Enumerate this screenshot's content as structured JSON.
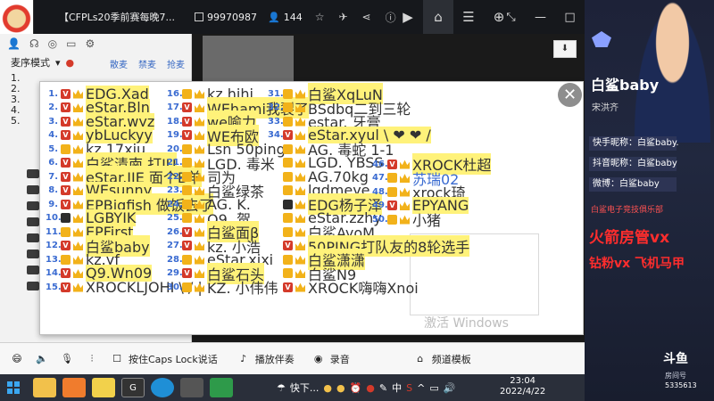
{
  "titlebar": {
    "title": "【CFPLs20季前赛每晚7...",
    "room_id": "99970987",
    "viewers": "144"
  },
  "sidepanel": {
    "mode_label": "麦序模式"
  },
  "tools": {
    "scatter": "散麦",
    "ban_mic": "禁麦",
    "grab_mic": "抢麦"
  },
  "scroll_btn": "⬇",
  "bg_list": [
    "1.",
    "2.",
    "3.",
    "4.",
    "5."
  ],
  "list": {
    "col1": [
      {
        "num": "1.",
        "name": "EDG.Xad",
        "badge": "v",
        "style": "y"
      },
      {
        "num": "2.",
        "name": "eStar.Bln",
        "badge": "v",
        "style": "y"
      },
      {
        "num": "3.",
        "name": "eStar.wyz",
        "badge": "v",
        "style": "y"
      },
      {
        "num": "4.",
        "name": "ybLuckyy",
        "badge": "v",
        "style": "y"
      },
      {
        "num": "5.",
        "name": "kz.17xiu",
        "badge": "c",
        "style": ""
      },
      {
        "num": "6.",
        "name": "白鲨清南 打JU",
        "badge": "v",
        "style": "y"
      },
      {
        "num": "7.",
        "name": "eStar.JIE 面个B羊",
        "badge": "v",
        "style": "y"
      },
      {
        "num": "8.",
        "name": "WEsunny",
        "badge": "v",
        "style": "y"
      },
      {
        "num": "9.",
        "name": "EPBigfish 做饭去了",
        "badge": "v",
        "style": "y"
      },
      {
        "num": "10.",
        "name": "LGBYIK",
        "badge": "k",
        "style": "y"
      },
      {
        "num": "11.",
        "name": "EPFirst",
        "badge": "c",
        "style": "y"
      },
      {
        "num": "12.",
        "name": "白鲨baby",
        "badge": "v",
        "style": "y"
      },
      {
        "num": "13.",
        "name": "kz.yf",
        "badge": "c",
        "style": ""
      },
      {
        "num": "14.",
        "name": "Q9.Wn09",
        "badge": "v",
        "style": "y"
      },
      {
        "num": "15.",
        "name": "XROCKLJOHI \\  /  |",
        "badge": "v",
        "style": ""
      }
    ],
    "col2": [
      {
        "num": "16.",
        "name": "kz.hihi",
        "badge": "c",
        "style": ""
      },
      {
        "num": "17.",
        "name": "WEhami我裂了",
        "badge": "v",
        "style": "y"
      },
      {
        "num": "18.",
        "name": "we喻力",
        "badge": "v",
        "style": "y"
      },
      {
        "num": "19.",
        "name": "WE布欧",
        "badge": "v",
        "style": "y"
      },
      {
        "num": "20.",
        "name": "Lsn 50ping",
        "badge": "c",
        "style": ""
      },
      {
        "num": "21.",
        "name": "LGD. 毒米",
        "badge": "c",
        "style": ""
      },
      {
        "num": "22.",
        "name": "司为",
        "badge": "c",
        "style": ""
      },
      {
        "num": "23.",
        "name": "白鲨绿茶",
        "badge": "c",
        "style": ""
      },
      {
        "num": "24.",
        "name": "AG. K.",
        "badge": "c",
        "style": ""
      },
      {
        "num": "25.",
        "name": "Q9. 贺",
        "badge": "c",
        "style": ""
      },
      {
        "num": "26.",
        "name": "白鲨面β",
        "badge": "v",
        "style": "y"
      },
      {
        "num": "27.",
        "name": "kz. 小浩",
        "badge": "v",
        "style": ""
      },
      {
        "num": "28.",
        "name": "eStar.xixi",
        "badge": "c",
        "style": ""
      },
      {
        "num": "29.",
        "name": "白鲨石头",
        "badge": "v",
        "style": "y"
      },
      {
        "num": "30.",
        "name": "KZ. 小伟伟",
        "badge": "c",
        "style": ""
      }
    ],
    "col3": [
      {
        "num": "31.",
        "name": "白鲨XqLuN",
        "badge": "c",
        "style": "y"
      },
      {
        "num": "32.",
        "name": "BSdbq二到三轮",
        "badge": "c",
        "style": ""
      },
      {
        "num": "33.",
        "name": "estar. 牙膏",
        "badge": "c",
        "style": ""
      },
      {
        "num": "34.",
        "name": "eStar.xyul \\ ❤ ❤ /",
        "badge": "v",
        "style": "y"
      },
      {
        "num": "",
        "name": "AG. 毒蛇 1-1",
        "badge": "c",
        "style": ""
      },
      {
        "num": "",
        "name": "LGD. YBSS",
        "badge": "c",
        "style": ""
      },
      {
        "num": "",
        "name": "AG.70kg",
        "badge": "c",
        "style": ""
      },
      {
        "num": "",
        "name": "lgdmeye",
        "badge": "c",
        "style": ""
      },
      {
        "num": "",
        "name": "EDG杨子泽",
        "badge": "k",
        "style": "y"
      },
      {
        "num": "",
        "name": "eStar.zzhy",
        "badge": "c",
        "style": ""
      },
      {
        "num": "",
        "name": "白鲨AyoM",
        "badge": "c",
        "style": ""
      },
      {
        "num": "",
        "name": "50PING打队友的8轮选手",
        "badge": "v",
        "style": "y"
      },
      {
        "num": "",
        "name": "白鲨潇潇",
        "badge": "c",
        "style": "y"
      },
      {
        "num": "",
        "name": "白鲨N9",
        "badge": "c",
        "style": ""
      },
      {
        "num": "",
        "name": "XROCK嗨嗨Xnoi",
        "badge": "v",
        "style": ""
      }
    ],
    "col4": [
      {
        "num": "46.",
        "name": "XROCK杜超",
        "badge": "v",
        "style": "y"
      },
      {
        "num": "47.",
        "name": "苏瑞02",
        "badge": "c",
        "style": "b"
      },
      {
        "num": "48.",
        "name": "xrock琦",
        "badge": "c",
        "style": ""
      },
      {
        "num": "49.",
        "name": "EPYANG",
        "badge": "v",
        "style": "y"
      },
      {
        "num": "50.",
        "name": "小猪",
        "badge": "c",
        "style": ""
      }
    ]
  },
  "watermark": "激活 Windows",
  "chatbar": {
    "caps": "按住Caps Lock说话",
    "accompany": "播放伴奏",
    "record": "录音",
    "mode": "频道模板"
  },
  "taskbar": {
    "quick": "快下...",
    "time": "23:04",
    "date": "2022/4/22",
    "ime": "中"
  },
  "streamer": {
    "name": "白鲨baby",
    "realname": "宋洪齐",
    "kuaishou": "快手昵称：白鲨baby.",
    "douyin": "抖音昵称：白鲨baby",
    "weibo": "微博：白鲨baby",
    "club": "白鲨电子竞技俱乐部",
    "ad1": "火箭房管vx",
    "ad2": "钻粉vx 飞机马甲",
    "platform": "斗鱼",
    "room_label": "房间号",
    "room_no": "5335613"
  }
}
